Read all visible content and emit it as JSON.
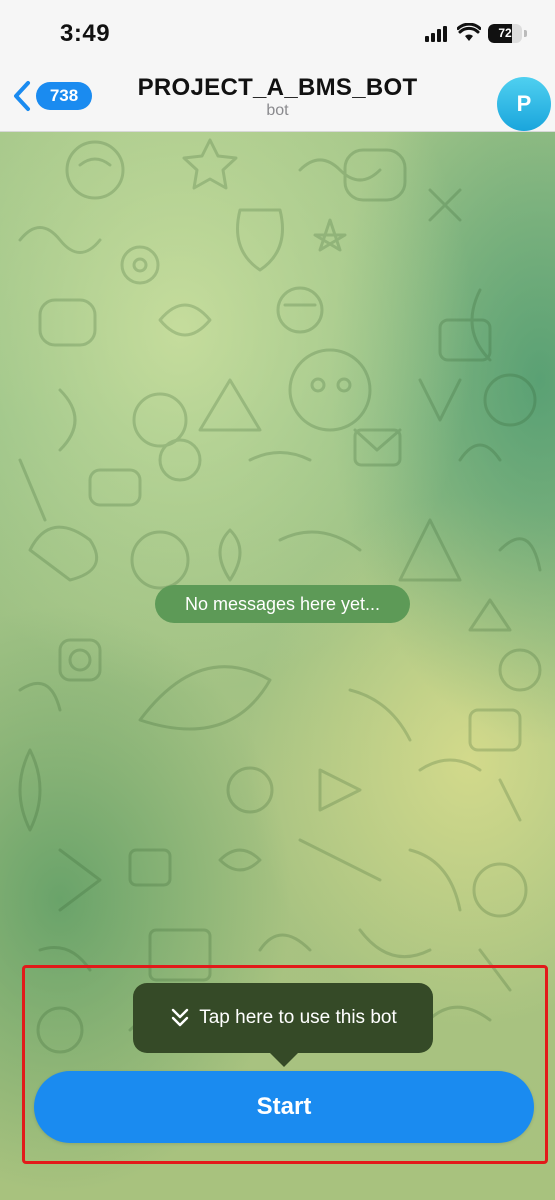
{
  "status_bar": {
    "time": "3:49",
    "battery": "72",
    "battery_level": 0.72,
    "icons": [
      "signal-icon",
      "wifi-icon",
      "battery-icon"
    ]
  },
  "header": {
    "back_count": "738",
    "title": "PROJECT_A_BMS_BOT",
    "subtitle": "bot",
    "avatar_letter": "P",
    "accent_color": "#1a8bf0",
    "avatar_color": "#2ab0e6"
  },
  "chat": {
    "empty_text": "No messages here yet..."
  },
  "bottom": {
    "tooltip_text": "Tap here to use this bot",
    "start_label": "Start",
    "highlight_color": "#e21a1a"
  }
}
